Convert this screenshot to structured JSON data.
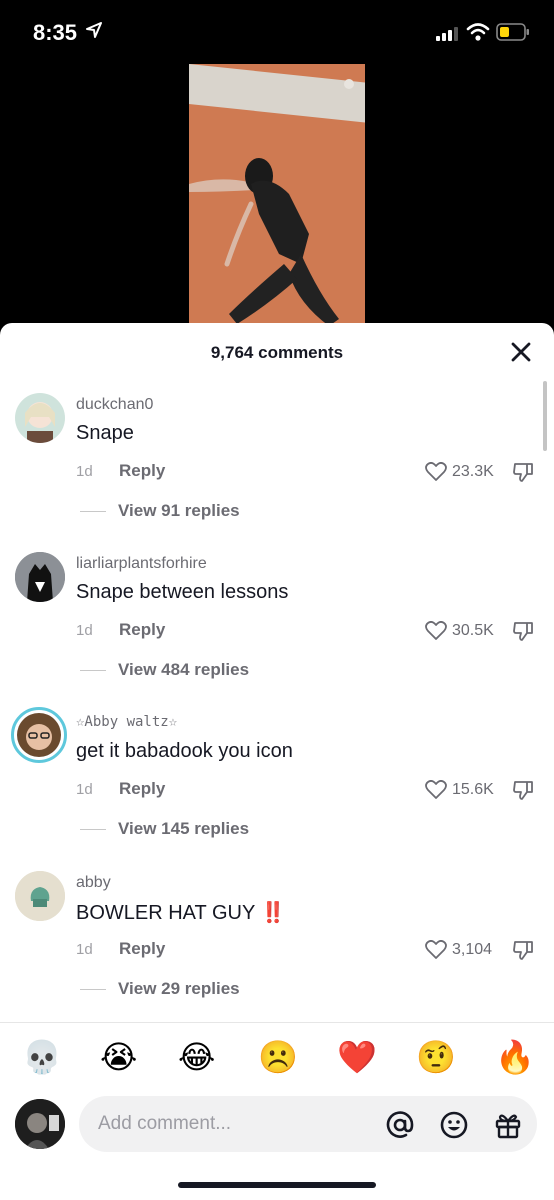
{
  "status": {
    "time": "8:35"
  },
  "sheet": {
    "title": "9,764 comments"
  },
  "comments": [
    {
      "username": "duckchan0",
      "text": "Snape",
      "date": "1d",
      "reply_label": "Reply",
      "likes": "23.3K",
      "view_replies": "View 91 replies"
    },
    {
      "username": "liarliarplantsforhire",
      "text": "Snape between lessons",
      "date": "1d",
      "reply_label": "Reply",
      "likes": "30.5K",
      "view_replies": "View 484 replies"
    },
    {
      "username": "☆Abby waltz☆",
      "text": "get it babadook you icon",
      "date": "1d",
      "reply_label": "Reply",
      "likes": "15.6K",
      "view_replies": "View 145 replies"
    },
    {
      "username": "abby",
      "text": "BOWLER HAT GUY",
      "text_emoji": "‼️",
      "date": "1d",
      "reply_label": "Reply",
      "likes": "3,104",
      "view_replies": "View 29 replies"
    }
  ],
  "emoji_bar": [
    "💀",
    "😭",
    "😂",
    "☹️",
    "❤️",
    "🤨",
    "🔥"
  ],
  "input": {
    "placeholder": "Add comment..."
  },
  "icons": {
    "close": "close-icon",
    "like": "heart-outline-icon",
    "dislike": "thumbs-down-icon",
    "mention": "at-sign-icon",
    "emoji": "smiley-icon",
    "gift": "gift-icon"
  },
  "colors": {
    "text_primary": "#161823",
    "text_secondary": "#6b6b72",
    "avatar_ring": "#5ec8dc",
    "exclamation": "#e0242f"
  }
}
